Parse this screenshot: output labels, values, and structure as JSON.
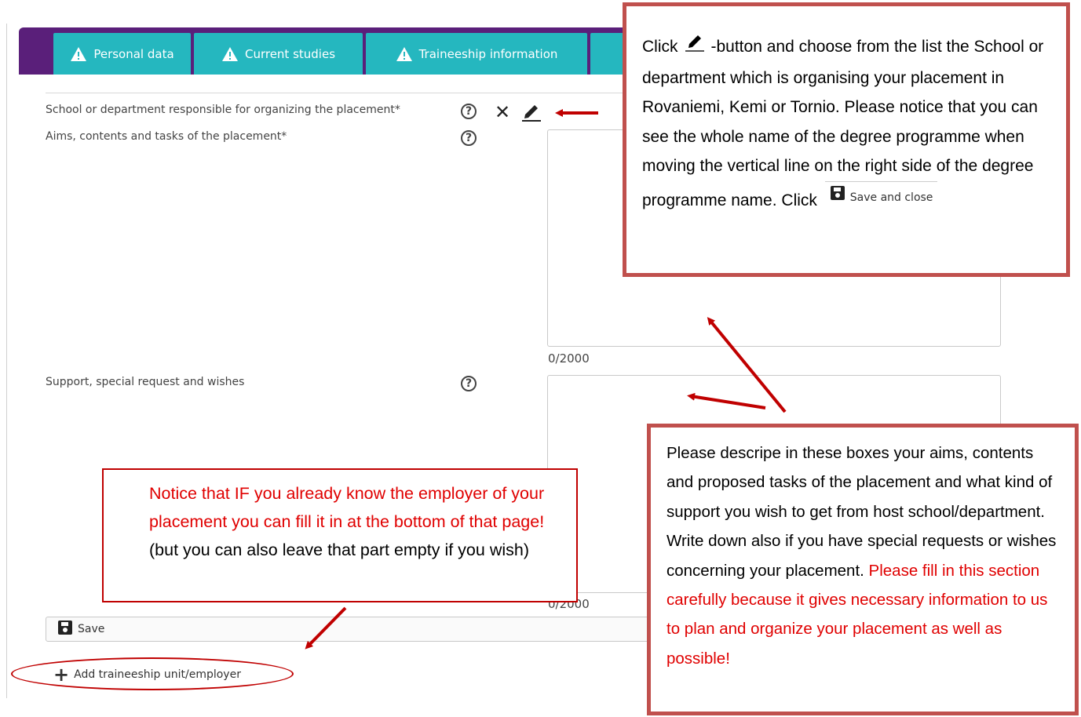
{
  "tabs": [
    {
      "label": "Personal data",
      "icon": "warning-icon"
    },
    {
      "label": "Current studies",
      "icon": "warning-icon"
    },
    {
      "label": "Traineeship information",
      "icon": "warning-icon"
    }
  ],
  "form": {
    "school_label": "School or department responsible for organizing the placement*",
    "aims_label": "Aims, contents and tasks of the placement*",
    "aims_counter": "0/2000",
    "support_label": "Support, special request and wishes",
    "support_counter": "0/2000",
    "help_glyph": "?",
    "clear_glyph": "✕",
    "save_label": "Save",
    "add_unit_label": "Add traineeship unit/employer"
  },
  "callouts": {
    "top": {
      "text_1": "Click",
      "text_2": "-button and choose from the list the School or department which is organising your placement in Rovaniemi, Kemi or Tornio. Please notice that you can see the whole name of the degree programme when moving the vertical line on the right side of the degree programme name. Click",
      "save_close_label": "Save and close"
    },
    "right": {
      "text_black": "Please descripe in these boxes your aims, contents and proposed tasks of the placement and what kind of support you wish to get from host school/department. Write down also if you have special requests or wishes concerning your placement.",
      "text_red": "Please fill in this section carefully because it gives necessary information to us to plan and organize your placement as well as possible!"
    },
    "left": {
      "text_red": "Notice that IF you already know the employer of your placement you can fill it in at the bottom of that page!",
      "text_black": "(but you can also leave that part empty if you wish)"
    }
  },
  "colors": {
    "tab_bar": "#5a1f7a",
    "tab": "#25b7bf",
    "callout_border": "#c0504d",
    "annotation_red": "#c00000"
  }
}
